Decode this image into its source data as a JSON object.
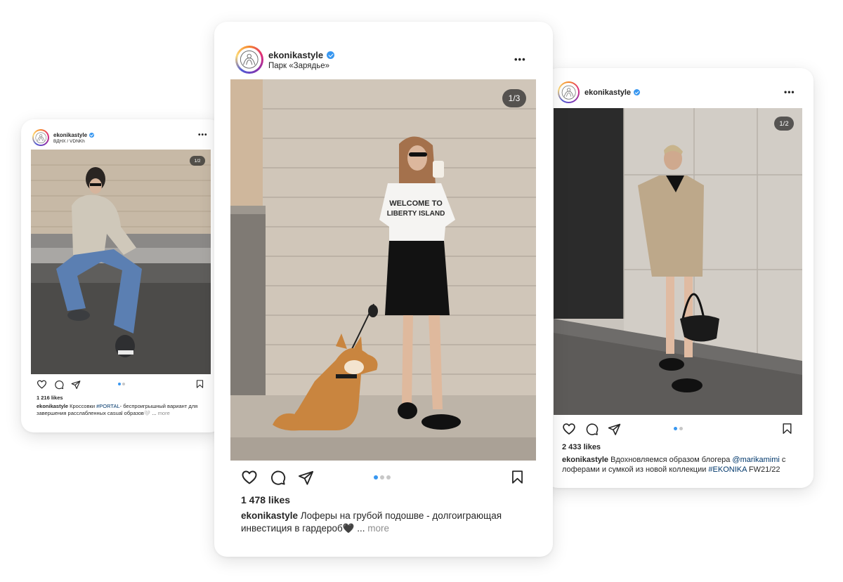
{
  "posts": {
    "left": {
      "username": "ekonikastyle",
      "location": "ВДНХ / VDNKh",
      "counter": "1/2",
      "likes": "1 216 likes",
      "caption_user": "ekonikastyle",
      "caption_a": " Кроссовки ",
      "caption_tag": "#PORTAL",
      "caption_b": "- беспроигрышный вариант для завершения расслабленных casual образов🤍 ... ",
      "caption_more": "more",
      "active_slide": 1,
      "total_slides": 2
    },
    "center": {
      "username": "ekonikastyle",
      "location": "Парк «Зарядье»",
      "counter": "1/3",
      "likes": "1 478 likes",
      "caption_user": "ekonikastyle",
      "caption_a": " Лоферы на грубой подошве - долгоиграющая инвестиция в гардероб🖤 ... ",
      "caption_more": "more",
      "shirt_text_1": "WELCOME TO",
      "shirt_text_2": "LIBERTY ISLAND",
      "active_slide": 1,
      "total_slides": 3
    },
    "right": {
      "username": "ekonikastyle",
      "counter": "1/2",
      "likes": "2 433 likes",
      "caption_user": "ekonikastyle",
      "caption_a": " Вдохновляемся образом блогера ",
      "caption_mention": "@marikamimi",
      "caption_b": " с лоферами и сумкой из новой коллекции ",
      "caption_tag": "#EKONIKA",
      "caption_c": " FW21/22",
      "active_slide": 1,
      "total_slides": 2
    }
  },
  "icons": [
    "heart-icon",
    "comment-icon",
    "share-icon",
    "bookmark-icon",
    "verified-icon",
    "more-icon"
  ],
  "colors": {
    "verified": "#3897f0",
    "active_dot": "#3897f0",
    "inactive_dot": "#c7c7c7",
    "link": "#00376b",
    "muted": "#8e8e8e"
  }
}
